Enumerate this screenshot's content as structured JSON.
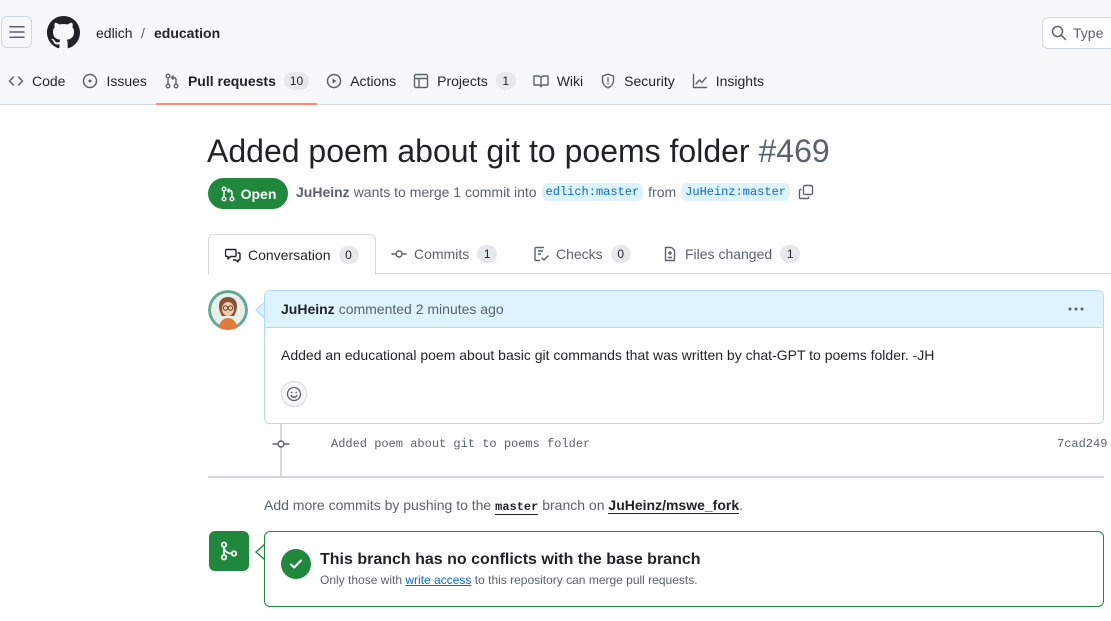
{
  "header": {
    "owner": "edlich",
    "separator": "/",
    "repo": "education",
    "search_placeholder": "Type"
  },
  "repo_tabs": [
    {
      "label": "Code",
      "icon": "code-icon",
      "count": null
    },
    {
      "label": "Issues",
      "icon": "issue-opened-icon",
      "count": null
    },
    {
      "label": "Pull requests",
      "icon": "git-pull-request-icon",
      "count": "10",
      "selected": true
    },
    {
      "label": "Actions",
      "icon": "play-icon",
      "count": null
    },
    {
      "label": "Projects",
      "icon": "table-icon",
      "count": "1"
    },
    {
      "label": "Wiki",
      "icon": "book-icon",
      "count": null
    },
    {
      "label": "Security",
      "icon": "shield-icon",
      "count": null
    },
    {
      "label": "Insights",
      "icon": "graph-icon",
      "count": null
    }
  ],
  "pr": {
    "title": "Added poem about git to poems folder",
    "number": "#469",
    "state": "Open",
    "author": "JuHeinz",
    "merge_text": "wants to merge 1 commit into",
    "base_branch": "edlich:master",
    "from_text": "from",
    "head_branch": "JuHeinz:master"
  },
  "pr_tabs": [
    {
      "label": "Conversation",
      "count": "0",
      "icon": "comment-discussion-icon",
      "selected": true
    },
    {
      "label": "Commits",
      "count": "1",
      "icon": "git-commit-icon"
    },
    {
      "label": "Checks",
      "count": "0",
      "icon": "checklist-icon"
    },
    {
      "label": "Files changed",
      "count": "1",
      "icon": "file-diff-icon"
    }
  ],
  "comment": {
    "author": "JuHeinz",
    "meta": "commented 2 minutes ago",
    "body": "Added an educational poem about basic git commands that was written by chat-GPT to poems folder. -JH"
  },
  "commit": {
    "message": "Added poem about git to poems folder",
    "sha": "7cad249"
  },
  "push_hint": {
    "prefix": "Add more commits by pushing to the",
    "branch": "master",
    "middle": "branch on",
    "repo": "JuHeinz/mswe_fork",
    "suffix": "."
  },
  "merge": {
    "title": "This branch has no conflicts with the base branch",
    "sub_prefix": "Only those with",
    "sub_link": "write access",
    "sub_suffix": "to this repository can merge pull requests."
  },
  "colors": {
    "accent_green": "#1f883d",
    "link_blue": "#0969da",
    "tab_underline": "#fd8c73"
  }
}
